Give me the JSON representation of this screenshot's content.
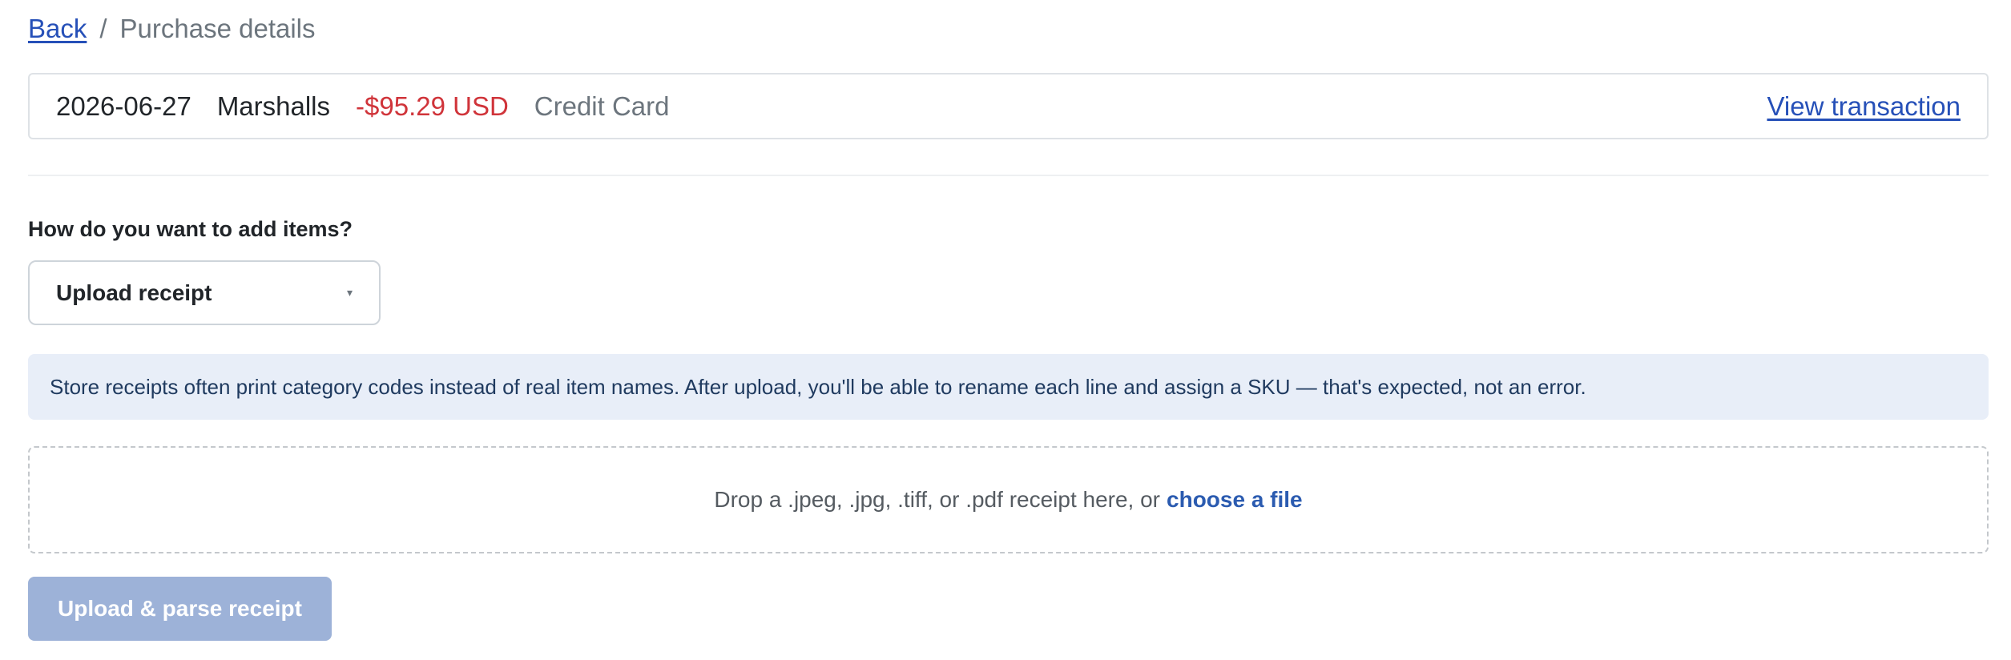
{
  "breadcrumb": {
    "back_label": "Back",
    "separator": "/",
    "current": "Purchase details"
  },
  "transaction": {
    "date": "2026-06-27",
    "merchant": "Marshalls",
    "amount": "-$95.29 USD",
    "method": "Credit Card",
    "view_label": "View transaction"
  },
  "add_items": {
    "question": "How do you want to add items?",
    "selected_option": "Upload receipt",
    "caret": "▾"
  },
  "info": {
    "message": "Store receipts often print category codes instead of real item names. After upload, you'll be able to rename each line and assign a SKU — that's expected, not an error."
  },
  "dropzone": {
    "prompt": "Drop a .jpeg, .jpg, .tiff, or .pdf receipt here, or",
    "choose_label": "choose a file"
  },
  "submit": {
    "label": "Upload & parse receipt"
  },
  "colors": {
    "link": "#2650b8",
    "amount_negative": "#d0343a",
    "info_bg": "#e8eef8",
    "button_disabled": "#9db2d8"
  }
}
